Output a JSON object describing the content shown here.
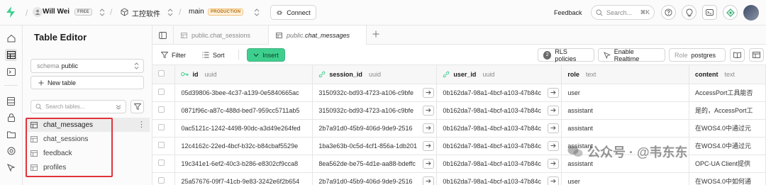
{
  "topbar": {
    "org": "Will Wei",
    "org_plan": "FREE",
    "project": "工控软件",
    "branch": "main",
    "branch_env": "PRODUCTION",
    "connect_label": "Connect",
    "feedback_label": "Feedback",
    "search_placeholder": "Search...",
    "search_shortcut": "⌘K"
  },
  "sidebar": {
    "title": "Table Editor",
    "schema_label": "schema",
    "schema_value": "public",
    "new_table_label": "New table",
    "search_placeholder": "Search tables...",
    "tables": [
      {
        "name": "chat_messages",
        "active": true
      },
      {
        "name": "chat_sessions",
        "active": false
      },
      {
        "name": "feedback",
        "active": false
      },
      {
        "name": "profiles",
        "active": false
      }
    ]
  },
  "tabs": [
    {
      "schema": "public.",
      "name": "chat_sessions",
      "active": false
    },
    {
      "schema": "public.",
      "name": "chat_messages",
      "active": true
    }
  ],
  "toolbar": {
    "filter_label": "Filter",
    "sort_label": "Sort",
    "insert_label": "Insert",
    "rls_label": "RLS policies",
    "rls_count": "2",
    "realtime_label": "Enable Realtime",
    "role_prefix": "Role",
    "role_value": "postgres"
  },
  "columns": [
    {
      "name": "id",
      "type": "uuid",
      "icon": "key-icon"
    },
    {
      "name": "session_id",
      "type": "uuid",
      "icon": "link-icon"
    },
    {
      "name": "user_id",
      "type": "uuid",
      "icon": "link-icon"
    },
    {
      "name": "role",
      "type": "text",
      "icon": ""
    },
    {
      "name": "content",
      "type": "text",
      "icon": ""
    }
  ],
  "rows": [
    {
      "id": "05d39806-3bee-4c37-a139-0e5840665ac",
      "session_id": "3150932c-bd93-4723-a106-c9bfe",
      "user_id": "0b162da7-98a1-4bcf-a103-47b84c",
      "role": "user",
      "content": "AccessPort工具能否"
    },
    {
      "id": "0871f96c-a87c-488d-bed7-959cc5711ab5",
      "session_id": "3150932c-bd93-4723-a106-c9bfe",
      "user_id": "0b162da7-98a1-4bcf-a103-47b84c",
      "role": "assistant",
      "content": "是的，AccessPort工"
    },
    {
      "id": "0ac5121c-1242-4498-90dc-a3d49e264fed",
      "session_id": "2b7a91d0-45b9-406d-9de9-2516",
      "user_id": "0b162da7-98a1-4bcf-a103-47b84c",
      "role": "assistant",
      "content": "在WOS4.0中通过元"
    },
    {
      "id": "12c4162c-22ed-4bcf-b32c-b84cbaf5529e",
      "session_id": "1ba3e63b-0c5d-4cf1-856a-1db201",
      "user_id": "0b162da7-98a1-4bcf-a103-47b84c",
      "role": "assistant",
      "content": "在WOS4.0中通过元"
    },
    {
      "id": "19c341e1-6ef2-40c3-b286-e8302cf9cca8",
      "session_id": "8ea562de-be75-4d1e-aa88-bdeffc",
      "user_id": "0b162da7-98a1-4bcf-a103-47b84c",
      "role": "assistant",
      "content": "OPC-UA Client提供"
    },
    {
      "id": "25a57676-09f7-41cb-9e83-3242e6f2b654",
      "session_id": "2b7a91d0-45b9-406d-9de9-2516",
      "user_id": "0b162da7-98a1-4bcf-a103-47b84c",
      "role": "user",
      "content": "在WOS4.0中如何通"
    }
  ],
  "watermark": "公众号 · @韦东东",
  "colors": {
    "accent": "#3ecf8e",
    "highlight": "#e0343a",
    "production": "#b86f05"
  }
}
